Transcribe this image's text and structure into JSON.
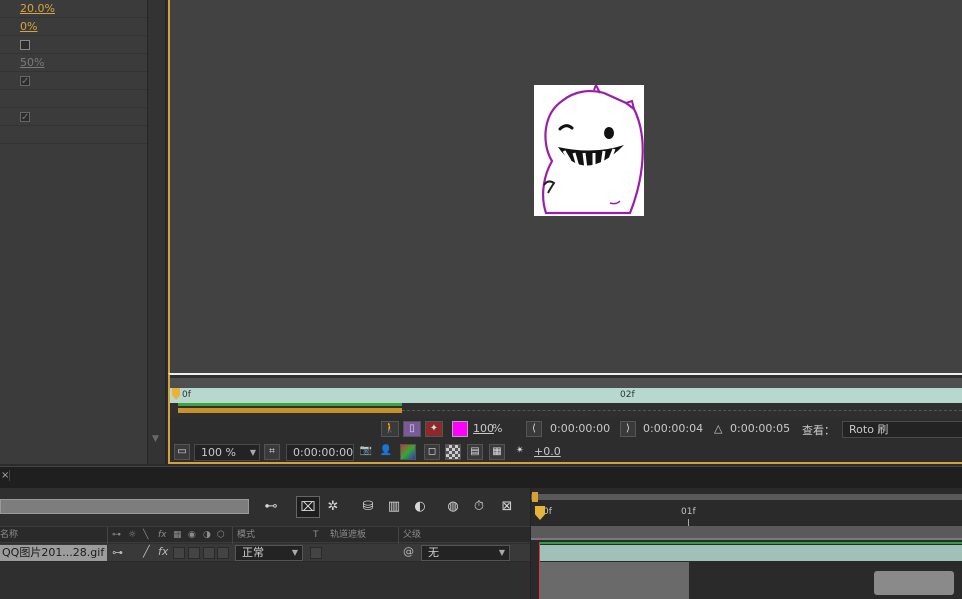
{
  "effect_controls": {
    "rows": [
      {
        "type": "value",
        "text": "20.0%",
        "dim": false
      },
      {
        "type": "value",
        "text": "0%",
        "dim": false
      },
      {
        "type": "checkbox",
        "checked": false
      },
      {
        "type": "value",
        "text": "50%",
        "dim": true
      },
      {
        "type": "checkbox",
        "checked": true
      },
      {
        "type": "empty"
      },
      {
        "type": "checkbox",
        "checked": true
      },
      {
        "type": "empty"
      }
    ]
  },
  "mini_timeline": {
    "start_label": "0f",
    "mid_label": "02f"
  },
  "viewer_controls_row1": {
    "magnify_pct": "100",
    "pct_symbol": "%",
    "time_in": "0:00:00:00",
    "time_out": "0:00:00:04",
    "delta_symbol": "△",
    "duration": "0:00:00:05",
    "view_label": "查看：",
    "view_value": "Roto 刷",
    "accent_color": "#ff00ff"
  },
  "viewer_controls_row2": {
    "zoom": "100 %",
    "current_time": "0:00:00:00",
    "exposure": "+0.0"
  },
  "timeline": {
    "columns": {
      "source_name": "名称",
      "mode": "模式",
      "t": "T",
      "trkmat": "轨道遮板",
      "parent": "父级"
    },
    "layer": {
      "name": "QQ图片201...28.gif",
      "mode": "正常",
      "parent": "无"
    },
    "ruler": {
      "t0": "0f",
      "t1": "01f"
    }
  }
}
